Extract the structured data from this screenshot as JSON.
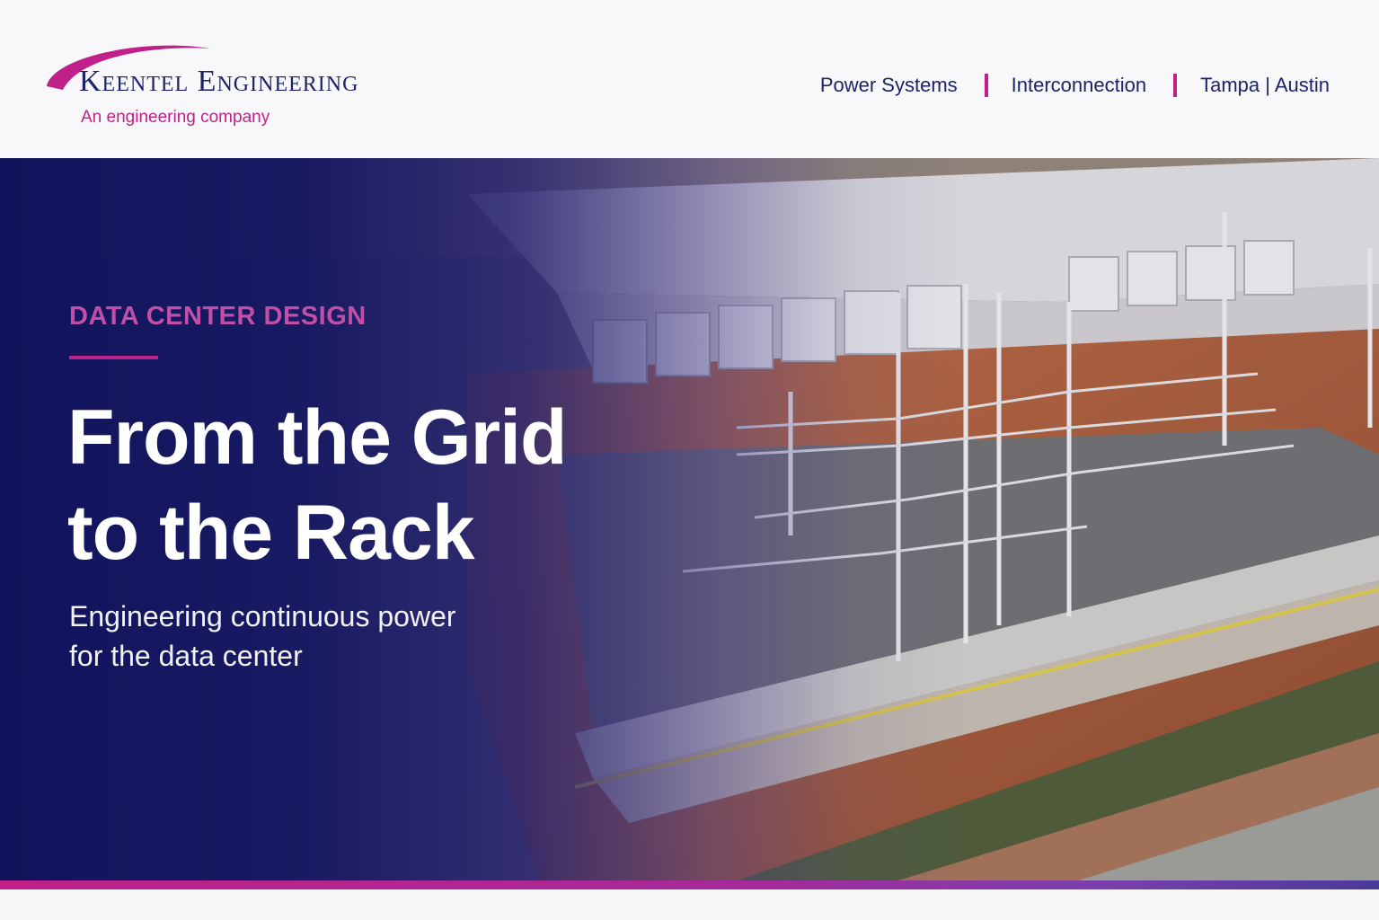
{
  "brand": {
    "name": "Keentel Engineering",
    "tagline": "An engineering company",
    "primary_color": "#1d2368",
    "accent_color": "#c0208a"
  },
  "nav": {
    "items": [
      {
        "label": "Power Systems"
      },
      {
        "label": "Interconnection"
      },
      {
        "label": "Tampa | Austin"
      }
    ]
  },
  "hero": {
    "eyebrow": "DATA CENTER DESIGN",
    "title_line1": "From the Grid",
    "title_line2": "to the Rack",
    "subtitle_line1": "Engineering continuous power",
    "subtitle_line2": "for the data center",
    "background_image": "aerial-substation-photo"
  }
}
